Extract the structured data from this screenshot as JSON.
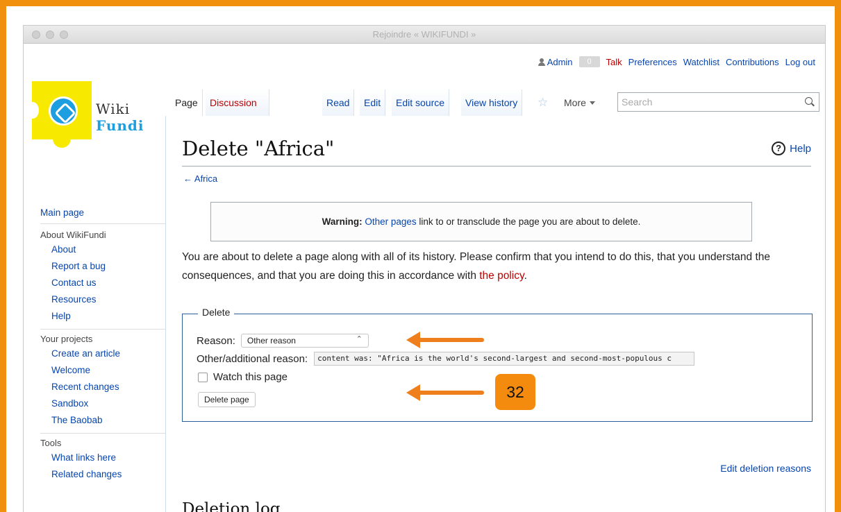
{
  "window": {
    "title": "Rejoindre « WIKIFUNDI »"
  },
  "personal_tools": {
    "user": "Admin",
    "notifications": "0",
    "talk": "Talk",
    "preferences": "Preferences",
    "watchlist": "Watchlist",
    "contributions": "Contributions",
    "logout": "Log out"
  },
  "logo": {
    "line1": "Wiki",
    "line2": "Fundi"
  },
  "sidebar": {
    "main_page": "Main page",
    "groups": [
      {
        "heading": "About WikiFundi",
        "items": [
          "About",
          "Report a bug",
          "Contact us",
          "Resources",
          "Help"
        ]
      },
      {
        "heading": "Your projects",
        "items": [
          "Create an article",
          "Welcome",
          "Recent changes",
          "Sandbox",
          "The Baobab"
        ]
      },
      {
        "heading": "Tools",
        "items": [
          "What links here",
          "Related changes"
        ]
      }
    ]
  },
  "tabs": {
    "page": "Page",
    "discussion": "Discussion",
    "read": "Read",
    "edit": "Edit",
    "edit_source": "Edit source",
    "view_history": "View history",
    "more": "More",
    "search_placeholder": "Search"
  },
  "content": {
    "title": "Delete \"Africa\"",
    "help": "Help",
    "back_link": "← Africa",
    "warning_label": "Warning:",
    "warning_link": "Other pages",
    "warning_rest": " link to or transclude the page you are about to delete.",
    "intro_text": "You are about to delete a page along with all of its history. Please confirm that you intend to do this, that you understand the consequences, and that you are doing this in accordance with ",
    "intro_link": "the policy",
    "intro_end": ".",
    "form": {
      "legend": "Delete",
      "reason_label": "Reason:",
      "reason_value": "Other reason",
      "other_label": "Other/additional reason:",
      "other_value": "content was: \"Africa is the world's second-largest and second-most-populous c",
      "watch_label": "Watch this page",
      "watch_checked": false,
      "delete_button": "Delete page"
    },
    "edit_deletion_reasons": "Edit deletion reasons",
    "deletion_log": "Deletion log"
  },
  "annotation": {
    "step_number": "32",
    "accent_color": "#f0900c"
  }
}
